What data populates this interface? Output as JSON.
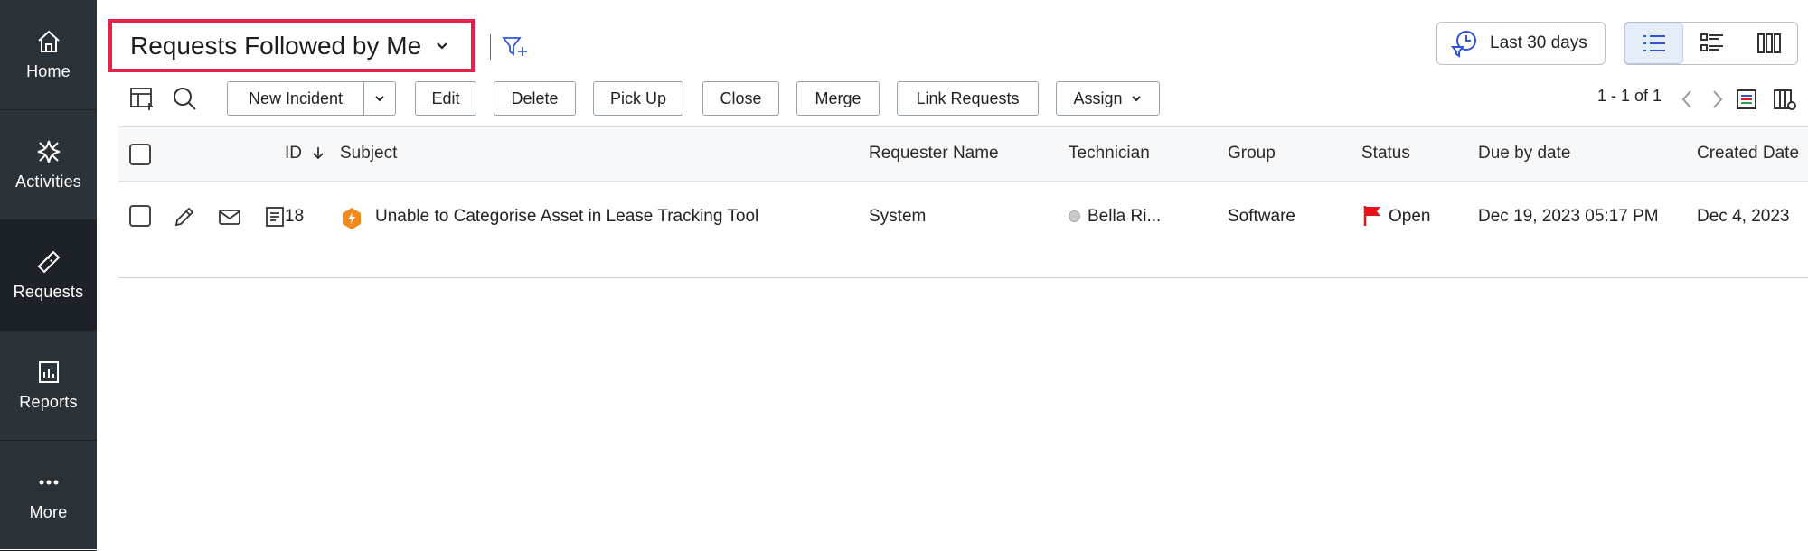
{
  "sidebar": {
    "items": [
      {
        "label": "Home",
        "icon": "home-icon"
      },
      {
        "label": "Activities",
        "icon": "activities-icon"
      },
      {
        "label": "Requests",
        "icon": "requests-icon"
      },
      {
        "label": "Reports",
        "icon": "reports-icon"
      },
      {
        "label": "More",
        "icon": "more-icon"
      }
    ],
    "active": "Requests"
  },
  "header": {
    "view_title": "Requests Followed by Me",
    "date_filter": "Last 30 days"
  },
  "toolbar": {
    "new_incident": "New Incident",
    "edit": "Edit",
    "delete": "Delete",
    "pick_up": "Pick Up",
    "close": "Close",
    "merge": "Merge",
    "link_requests": "Link Requests",
    "assign": "Assign",
    "pagination": "1 - 1 of 1"
  },
  "table": {
    "columns": [
      "ID",
      "Subject",
      "Requester Name",
      "Technician",
      "Group",
      "Status",
      "Due by date",
      "Created Date"
    ],
    "rows": [
      {
        "id": "18",
        "subject": "Unable to Categorise Asset in Lease Tracking Tool",
        "requester": "System",
        "technician": "Bella Ri...",
        "group": "Software",
        "status": "Open",
        "due_by": "Dec 19, 2023 05:17 PM",
        "created": "Dec 4, 2023"
      }
    ]
  },
  "colors": {
    "sidebar_bg": "#2b3238",
    "highlight_border": "#e8214a",
    "accent": "#2f54d6",
    "status_open": "#e3151a",
    "incident_icon": "#f08a1c"
  }
}
